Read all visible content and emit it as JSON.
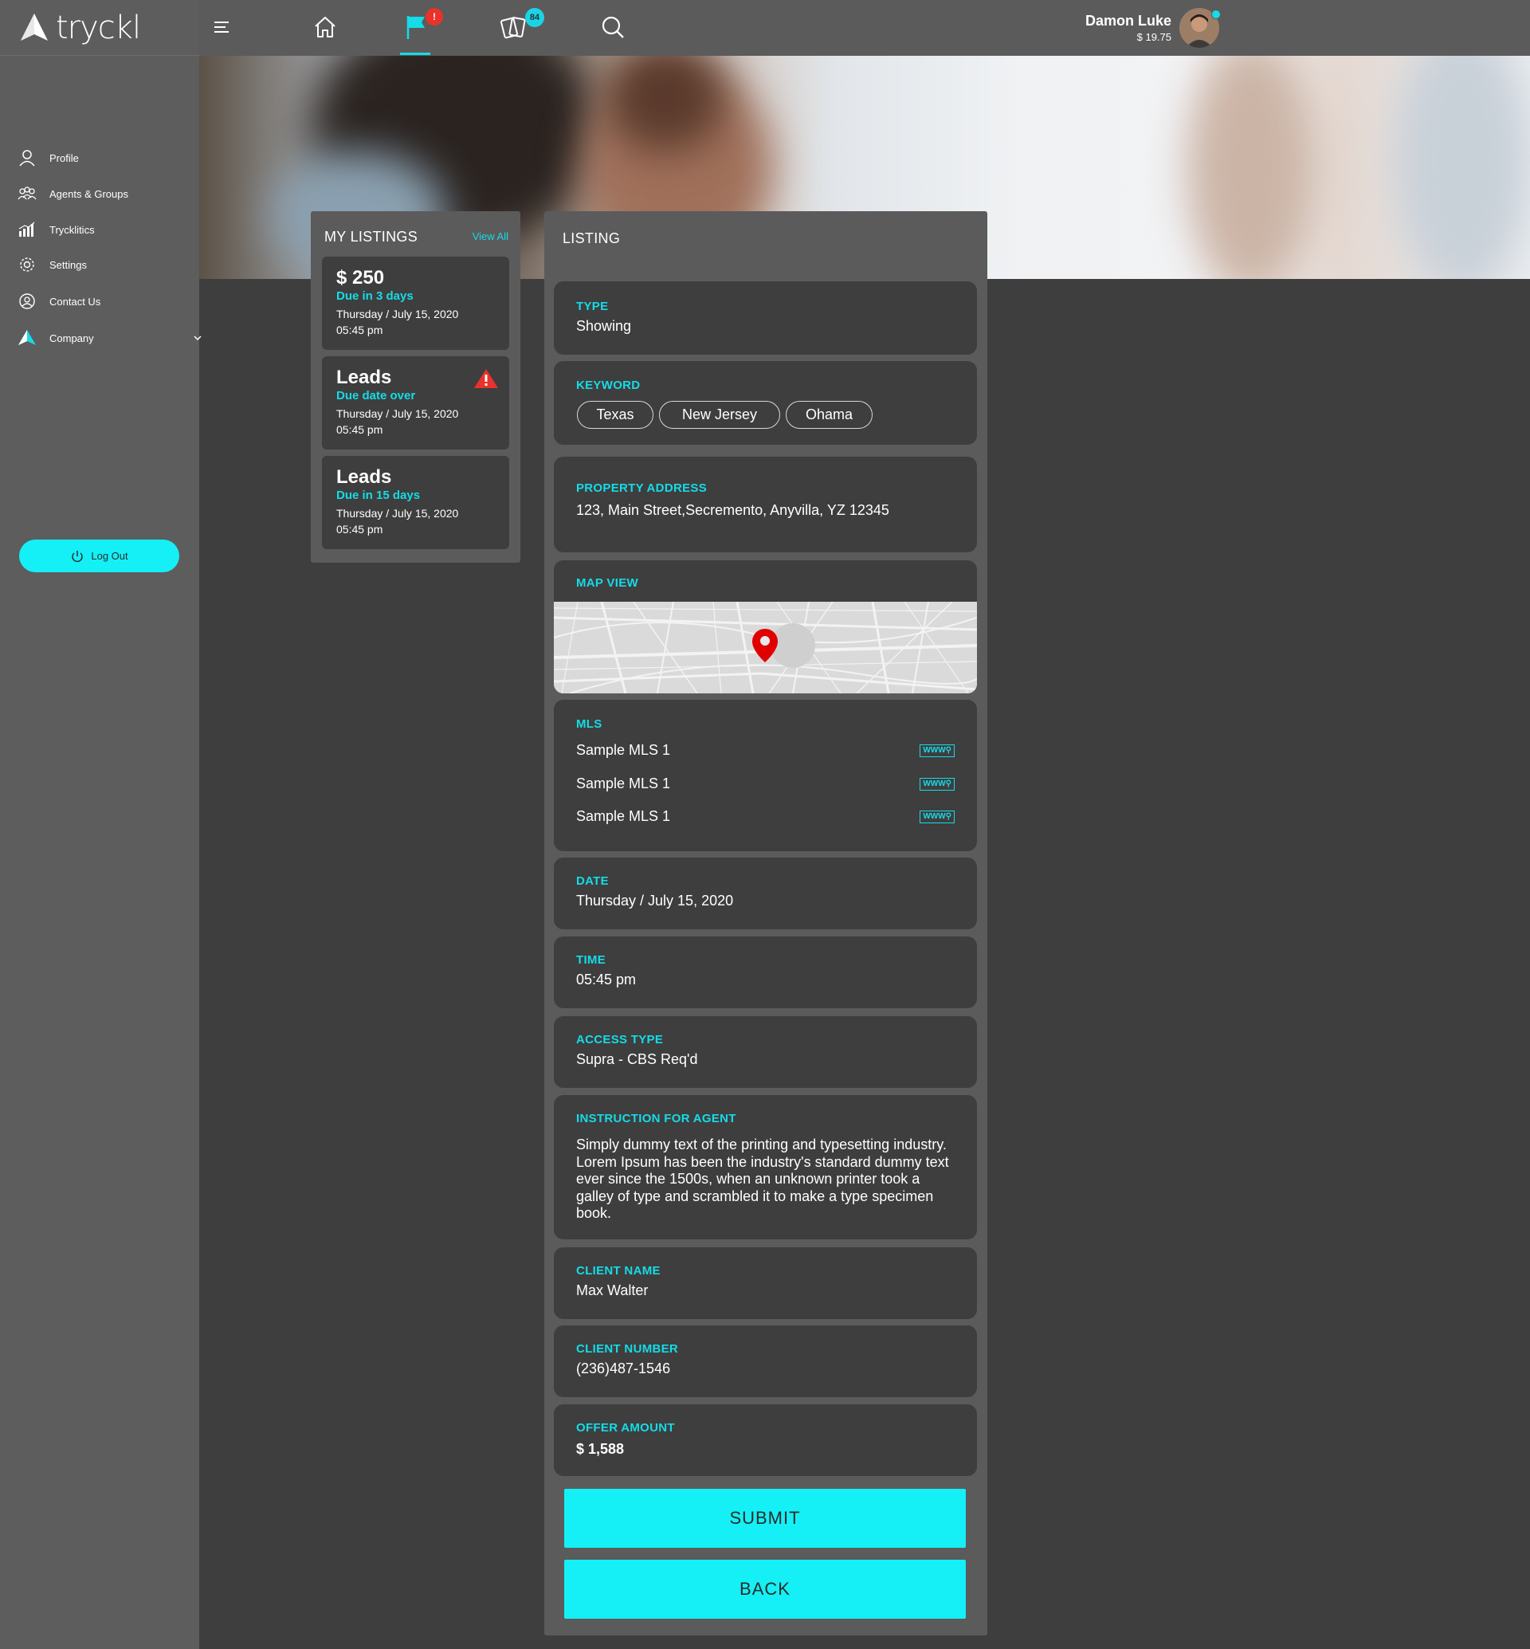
{
  "brand": {
    "name": "tryckl"
  },
  "topbar": {
    "flag_badge": "!",
    "cards_badge": "84",
    "user_name": "Damon Luke",
    "user_balance": "$ 19.75"
  },
  "sidebar": {
    "items": [
      {
        "label": "Profile",
        "icon": "person-icon"
      },
      {
        "label": "Agents & Groups",
        "icon": "group-icon"
      },
      {
        "label": "Trycklitics",
        "icon": "bar-chart-icon"
      },
      {
        "label": "Settings",
        "icon": "gear-icon"
      },
      {
        "label": "Contact Us",
        "icon": "contact-icon"
      },
      {
        "label": "Company",
        "icon": "tryckl-logo-icon"
      }
    ],
    "logout_label": "Log Out"
  },
  "my_listings": {
    "title": "MY LISTINGS",
    "view_all": "View All",
    "cards": [
      {
        "title": "$ 250",
        "due": "Due in 3 days",
        "date": "Thursday / July 15, 2020",
        "time": "05:45 pm",
        "warning": false
      },
      {
        "title": "Leads",
        "due": "Due date over",
        "date": "Thursday / July 15, 2020",
        "time": "05:45 pm",
        "warning": true
      },
      {
        "title": "Leads",
        "due": "Due in 15 days",
        "date": "Thursday / July 15, 2020",
        "time": "05:45 pm",
        "warning": false
      }
    ]
  },
  "listing": {
    "title": "LISTING",
    "type": {
      "label": "TYPE",
      "value": "Showing"
    },
    "keyword": {
      "label": "KEYWORD",
      "chips": [
        "Texas",
        "New Jersey",
        "Ohama"
      ]
    },
    "address": {
      "label": "PROPERTY ADDRESS",
      "value": "123, Main Street,Secremento, Anyvilla, YZ 12345"
    },
    "map": {
      "label": "MAP VIEW"
    },
    "mls": {
      "label": "MLS",
      "items": [
        "Sample MLS 1",
        "Sample MLS 1",
        "Sample MLS 1"
      ],
      "icon_text": "WWW"
    },
    "date": {
      "label": "DATE",
      "value": "Thursday / July 15, 2020"
    },
    "time": {
      "label": "TIME",
      "value": "05:45 pm"
    },
    "access": {
      "label": "ACCESS TYPE",
      "value": "Supra - CBS Req'd"
    },
    "instruction": {
      "label": "INSTRUCTION FOR AGENT",
      "value": "Simply dummy text of the printing and typesetting industry. Lorem Ipsum has been the industry's standard dummy text ever since the 1500s, when an unknown printer took a galley of type and scrambled it to make a type specimen book."
    },
    "client_name": {
      "label": "CLIENT NAME",
      "value": "Max Walter"
    },
    "client_number": {
      "label": "CLIENT NUMBER",
      "value": "(236)487-1546"
    },
    "offer": {
      "label": "OFFER AMOUNT",
      "value": "$ 1,588"
    },
    "submit_label": "SUBMIT",
    "back_label": "BACK"
  },
  "colors": {
    "accent": "#14f0f6",
    "accent_text": "#14dce8",
    "panel": "#5b5b5b",
    "card": "#3e3e3e",
    "alert": "#e8322b"
  }
}
